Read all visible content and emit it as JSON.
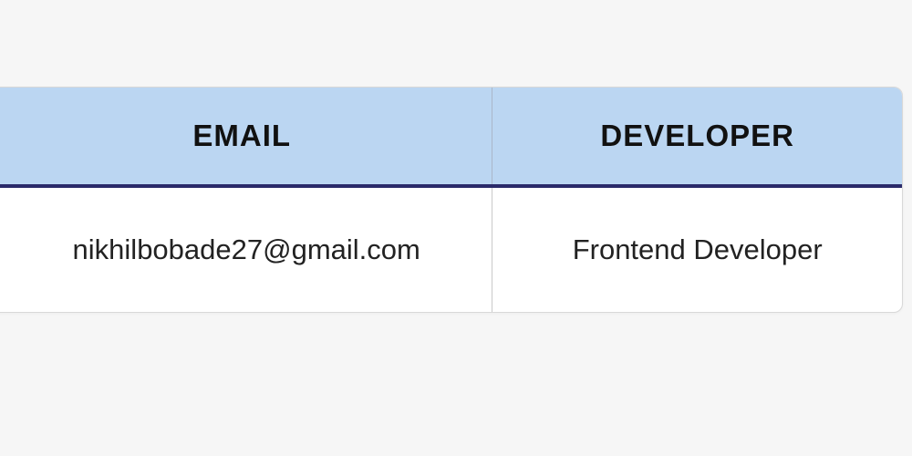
{
  "table": {
    "headers": {
      "email": "EMAIL",
      "developer": "DEVELOPER"
    },
    "rows": [
      {
        "email": "nikhilbobade27@gmail.com",
        "developer": "Frontend Developer"
      }
    ]
  }
}
